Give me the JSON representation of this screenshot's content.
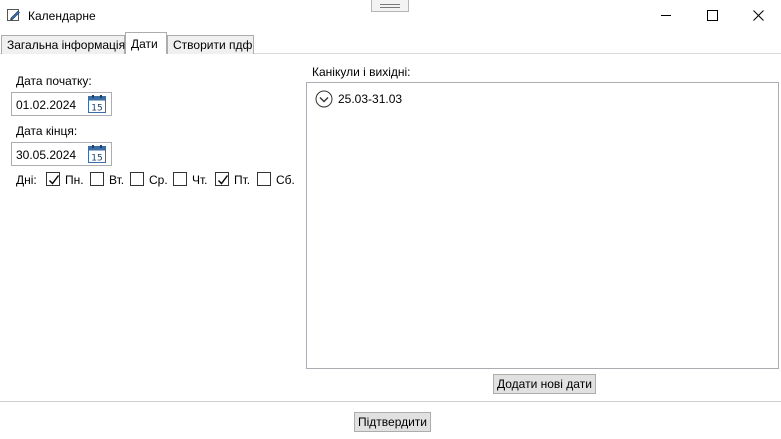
{
  "window": {
    "title": "Календарне",
    "icon": "pencil-icon",
    "controls": [
      "minimize-icon",
      "maximize-icon",
      "close-icon"
    ]
  },
  "tabs": [
    {
      "label": "Загальна інформація",
      "active": false
    },
    {
      "label": "Дати",
      "active": true
    },
    {
      "label": "Створити пдф",
      "active": false
    }
  ],
  "form": {
    "start_date_label": "Дата початку:",
    "start_date_value": "01.02.2024",
    "end_date_label": "Дата кінця:",
    "end_date_value": "30.05.2024",
    "calendar_icon_text": "15",
    "days_label": "Дні:",
    "days": [
      {
        "label": "Пн.",
        "checked": true
      },
      {
        "label": "Вт.",
        "checked": false
      },
      {
        "label": "Ср.",
        "checked": false
      },
      {
        "label": "Чт.",
        "checked": false
      },
      {
        "label": "Пт.",
        "checked": true
      },
      {
        "label": "Сб.",
        "checked": false
      }
    ]
  },
  "holidays": {
    "label": "Канікули і вихідні:",
    "items": [
      {
        "label": "25.03-31.03",
        "icon": "chevron-down-circle-icon"
      }
    ],
    "add_button": "Додати нові дати"
  },
  "confirm_button": "Підтвердити",
  "colors": {
    "border": "#abadb3",
    "button_bg": "#e1e1e1",
    "tab_inactive_bg": "#f0f0f0",
    "calendar_icon_blue": "#3a6ea5"
  }
}
